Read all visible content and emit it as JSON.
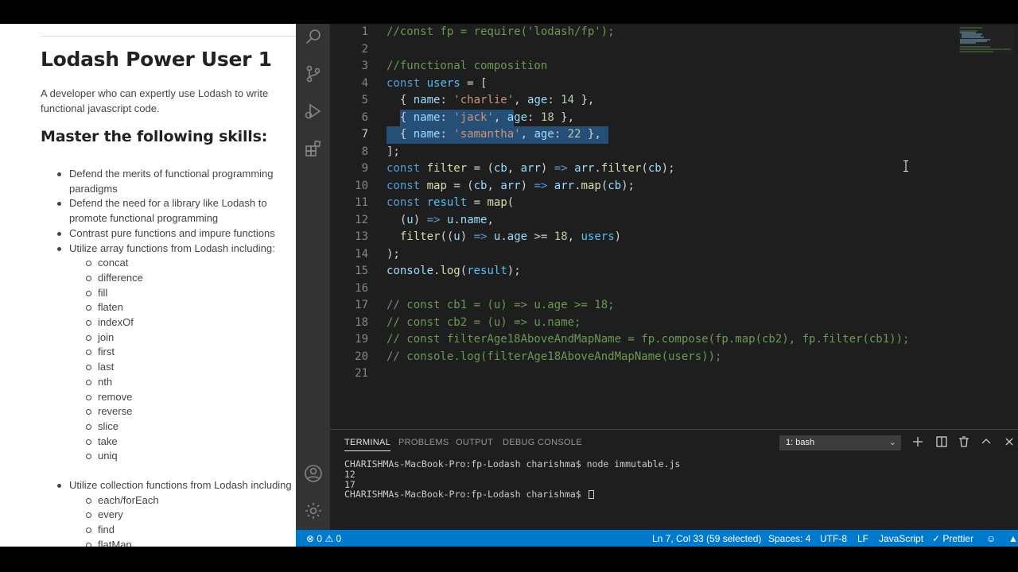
{
  "doc": {
    "title": "Lodash Power User 1",
    "description": "A developer who can expertly use Lodash to write functional javascript code.",
    "skills_heading": "Master the following skills:",
    "skills": [
      {
        "line1": "Defend the merits of functional programming",
        "line2": "paradigms"
      },
      {
        "line1": "Defend the need for a library like Lodash to",
        "line2": "promote functional programming"
      },
      {
        "line1": "Contrast pure functions and impure functions"
      },
      {
        "line1": "Utilize array functions from Lodash including:"
      }
    ],
    "array_functions": [
      "concat",
      "difference",
      "fill",
      "flaten",
      "indexOf",
      "join",
      "first",
      "last",
      "nth",
      "remove",
      "reverse",
      "slice",
      "take",
      "uniq"
    ],
    "collection_heading": "Utilize collection functions from Lodash including",
    "collection_functions": [
      "each/forEach",
      "every",
      "find",
      "flatMap"
    ]
  },
  "activity_bar": {
    "icons": [
      "search-icon",
      "source-control-icon",
      "run-debug-icon",
      "extensions-icon",
      "account-icon",
      "settings-gear-icon"
    ]
  },
  "editor": {
    "line_numbers": [
      "1",
      "2",
      "3",
      "4",
      "5",
      "6",
      "7",
      "8",
      "9",
      "10",
      "11",
      "12",
      "13",
      "14",
      "15",
      "16",
      "17",
      "18",
      "19",
      "20",
      "21"
    ],
    "lines": [
      [
        {
          "t": "//const fp = require('lodash/fp');",
          "c": "com"
        }
      ],
      [],
      [
        {
          "t": "//functional composition",
          "c": "com"
        }
      ],
      [
        {
          "t": "const",
          "c": "kw"
        },
        {
          "t": " ",
          "c": "pn"
        },
        {
          "t": "users",
          "c": "var"
        },
        {
          "t": " = [",
          "c": "pn"
        }
      ],
      [
        {
          "t": "  { ",
          "c": "pn"
        },
        {
          "t": "name",
          "c": "prop"
        },
        {
          "t": ": ",
          "c": "pn"
        },
        {
          "t": "'charlie'",
          "c": "str"
        },
        {
          "t": ", ",
          "c": "pn"
        },
        {
          "t": "age",
          "c": "prop"
        },
        {
          "t": ": ",
          "c": "pn"
        },
        {
          "t": "14",
          "c": "num"
        },
        {
          "t": " },",
          "c": "pn"
        }
      ],
      [
        {
          "t": "  { ",
          "c": "pn"
        },
        {
          "t": "name",
          "c": "prop"
        },
        {
          "t": ": ",
          "c": "pn"
        },
        {
          "t": "'jack'",
          "c": "str"
        },
        {
          "t": ", ",
          "c": "pn"
        },
        {
          "t": "age",
          "c": "prop"
        },
        {
          "t": ": ",
          "c": "pn"
        },
        {
          "t": "18",
          "c": "num"
        },
        {
          "t": " },",
          "c": "pn"
        }
      ],
      [
        {
          "t": "  { ",
          "c": "pn"
        },
        {
          "t": "name",
          "c": "prop"
        },
        {
          "t": ": ",
          "c": "pn"
        },
        {
          "t": "'samantha'",
          "c": "str"
        },
        {
          "t": ", ",
          "c": "pn"
        },
        {
          "t": "age",
          "c": "prop"
        },
        {
          "t": ": ",
          "c": "pn"
        },
        {
          "t": "22",
          "c": "num"
        },
        {
          "t": " },",
          "c": "pn"
        }
      ],
      [
        {
          "t": "];",
          "c": "pn"
        }
      ],
      [
        {
          "t": "const",
          "c": "kw"
        },
        {
          "t": " ",
          "c": "pn"
        },
        {
          "t": "filter",
          "c": "fn"
        },
        {
          "t": " = (",
          "c": "pn"
        },
        {
          "t": "cb",
          "c": "prop"
        },
        {
          "t": ", ",
          "c": "pn"
        },
        {
          "t": "arr",
          "c": "prop"
        },
        {
          "t": ") ",
          "c": "pn"
        },
        {
          "t": "=>",
          "c": "kw"
        },
        {
          "t": " ",
          "c": "pn"
        },
        {
          "t": "arr",
          "c": "prop"
        },
        {
          "t": ".",
          "c": "pn"
        },
        {
          "t": "filter",
          "c": "fn"
        },
        {
          "t": "(",
          "c": "pn"
        },
        {
          "t": "cb",
          "c": "prop"
        },
        {
          "t": ");",
          "c": "pn"
        }
      ],
      [
        {
          "t": "const",
          "c": "kw"
        },
        {
          "t": " ",
          "c": "pn"
        },
        {
          "t": "map",
          "c": "fn"
        },
        {
          "t": " = (",
          "c": "pn"
        },
        {
          "t": "cb",
          "c": "prop"
        },
        {
          "t": ", ",
          "c": "pn"
        },
        {
          "t": "arr",
          "c": "prop"
        },
        {
          "t": ") ",
          "c": "pn"
        },
        {
          "t": "=>",
          "c": "kw"
        },
        {
          "t": " ",
          "c": "pn"
        },
        {
          "t": "arr",
          "c": "prop"
        },
        {
          "t": ".",
          "c": "pn"
        },
        {
          "t": "map",
          "c": "fn"
        },
        {
          "t": "(",
          "c": "pn"
        },
        {
          "t": "cb",
          "c": "prop"
        },
        {
          "t": ");",
          "c": "pn"
        }
      ],
      [
        {
          "t": "const",
          "c": "kw"
        },
        {
          "t": " ",
          "c": "pn"
        },
        {
          "t": "result",
          "c": "var"
        },
        {
          "t": " = ",
          "c": "pn"
        },
        {
          "t": "map",
          "c": "fn"
        },
        {
          "t": "(",
          "c": "pn"
        }
      ],
      [
        {
          "t": "  (",
          "c": "pn"
        },
        {
          "t": "u",
          "c": "prop"
        },
        {
          "t": ") ",
          "c": "pn"
        },
        {
          "t": "=>",
          "c": "kw"
        },
        {
          "t": " ",
          "c": "pn"
        },
        {
          "t": "u",
          "c": "prop"
        },
        {
          "t": ".",
          "c": "pn"
        },
        {
          "t": "name",
          "c": "prop"
        },
        {
          "t": ",",
          "c": "pn"
        }
      ],
      [
        {
          "t": "  ",
          "c": "pn"
        },
        {
          "t": "filter",
          "c": "fn"
        },
        {
          "t": "((",
          "c": "pn"
        },
        {
          "t": "u",
          "c": "prop"
        },
        {
          "t": ") ",
          "c": "pn"
        },
        {
          "t": "=>",
          "c": "kw"
        },
        {
          "t": " ",
          "c": "pn"
        },
        {
          "t": "u",
          "c": "prop"
        },
        {
          "t": ".",
          "c": "pn"
        },
        {
          "t": "age",
          "c": "prop"
        },
        {
          "t": " >= ",
          "c": "pn"
        },
        {
          "t": "18",
          "c": "num"
        },
        {
          "t": ", ",
          "c": "pn"
        },
        {
          "t": "users",
          "c": "var"
        },
        {
          "t": ")",
          "c": "pn"
        }
      ],
      [
        {
          "t": ");",
          "c": "pn"
        }
      ],
      [
        {
          "t": "console",
          "c": "prop"
        },
        {
          "t": ".",
          "c": "pn"
        },
        {
          "t": "log",
          "c": "fn"
        },
        {
          "t": "(",
          "c": "pn"
        },
        {
          "t": "result",
          "c": "var"
        },
        {
          "t": ");",
          "c": "pn"
        }
      ],
      [],
      [
        {
          "t": "// const cb1 = (u) => u.age >= 18;",
          "c": "com"
        }
      ],
      [
        {
          "t": "// const cb2 = (u) => u.name;",
          "c": "com"
        }
      ],
      [
        {
          "t": "// const filterAge18AboveAndMapName = fp.compose(fp.map(cb2), fp.filter(cb1));",
          "c": "com"
        }
      ],
      [
        {
          "t": "// console.log(filterAge18AboveAndMapName(users));",
          "c": "com"
        }
      ],
      []
    ],
    "selection_color": "#264f78",
    "active_line": "7"
  },
  "panel": {
    "tabs": [
      "TERMINAL",
      "PROBLEMS",
      "OUTPUT",
      "DEBUG CONSOLE"
    ],
    "active_tab": "TERMINAL",
    "shell_select": "1: bash",
    "shell_chevron": "⌄",
    "terminal_lines": [
      "CHARISHMAs-MacBook-Pro:fp-Lodash charishma$ node immutable.js",
      "12",
      "17",
      "CHARISHMAs-MacBook-Pro:fp-Lodash charishma$ "
    ]
  },
  "status_bar": {
    "errors": "0",
    "warnings": "0",
    "position": "Ln 7, Col 33 (59 selected)",
    "spaces": "Spaces: 4",
    "encoding": "UTF-8",
    "eol": "LF",
    "language": "JavaScript",
    "formatter": "Prettier",
    "color": "#007acc"
  }
}
